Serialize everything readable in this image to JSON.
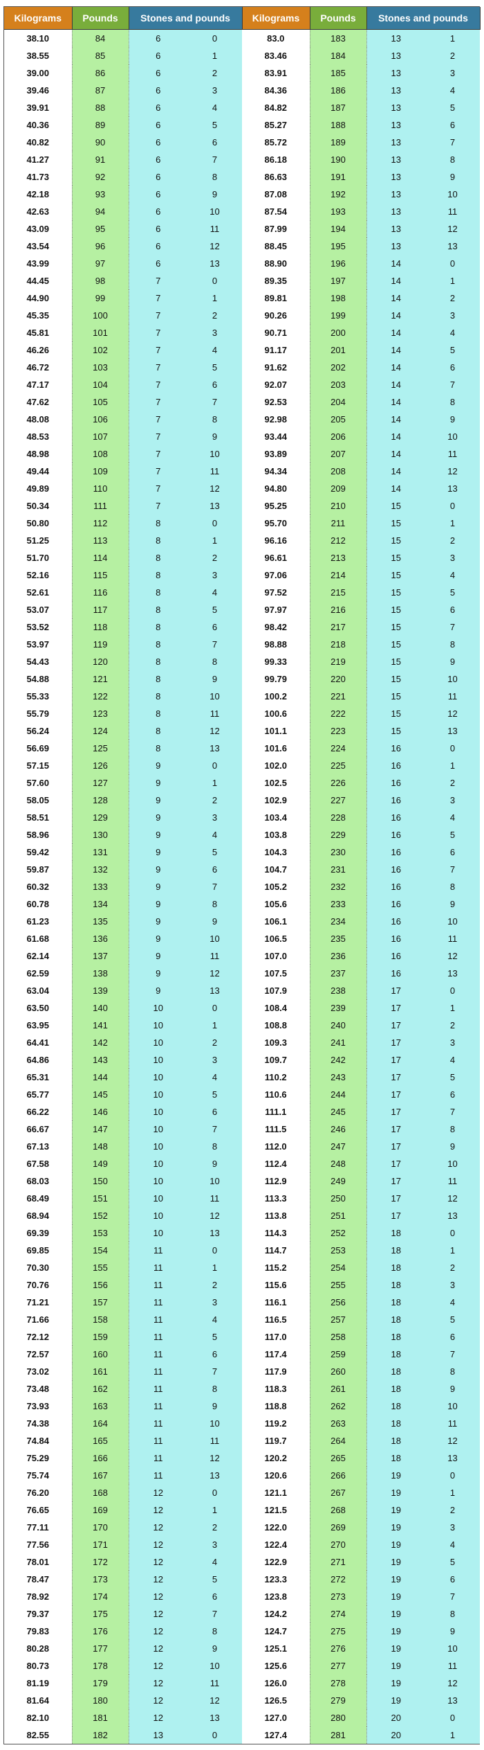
{
  "headers": {
    "kilograms": "Kilograms",
    "pounds": "Pounds",
    "stones_pounds": "Stones and pounds"
  },
  "left": [
    [
      "38.10",
      "84",
      "6",
      "0"
    ],
    [
      "38.55",
      "85",
      "6",
      "1"
    ],
    [
      "39.00",
      "86",
      "6",
      "2"
    ],
    [
      "39.46",
      "87",
      "6",
      "3"
    ],
    [
      "39.91",
      "88",
      "6",
      "4"
    ],
    [
      "40.36",
      "89",
      "6",
      "5"
    ],
    [
      "40.82",
      "90",
      "6",
      "6"
    ],
    [
      "41.27",
      "91",
      "6",
      "7"
    ],
    [
      "41.73",
      "92",
      "6",
      "8"
    ],
    [
      "42.18",
      "93",
      "6",
      "9"
    ],
    [
      "42.63",
      "94",
      "6",
      "10"
    ],
    [
      "43.09",
      "95",
      "6",
      "11"
    ],
    [
      "43.54",
      "96",
      "6",
      "12"
    ],
    [
      "43.99",
      "97",
      "6",
      "13"
    ],
    [
      "44.45",
      "98",
      "7",
      "0"
    ],
    [
      "44.90",
      "99",
      "7",
      "1"
    ],
    [
      "45.35",
      "100",
      "7",
      "2"
    ],
    [
      "45.81",
      "101",
      "7",
      "3"
    ],
    [
      "46.26",
      "102",
      "7",
      "4"
    ],
    [
      "46.72",
      "103",
      "7",
      "5"
    ],
    [
      "47.17",
      "104",
      "7",
      "6"
    ],
    [
      "47.62",
      "105",
      "7",
      "7"
    ],
    [
      "48.08",
      "106",
      "7",
      "8"
    ],
    [
      "48.53",
      "107",
      "7",
      "9"
    ],
    [
      "48.98",
      "108",
      "7",
      "10"
    ],
    [
      "49.44",
      "109",
      "7",
      "11"
    ],
    [
      "49.89",
      "110",
      "7",
      "12"
    ],
    [
      "50.34",
      "111",
      "7",
      "13"
    ],
    [
      "50.80",
      "112",
      "8",
      "0"
    ],
    [
      "51.25",
      "113",
      "8",
      "1"
    ],
    [
      "51.70",
      "114",
      "8",
      "2"
    ],
    [
      "52.16",
      "115",
      "8",
      "3"
    ],
    [
      "52.61",
      "116",
      "8",
      "4"
    ],
    [
      "53.07",
      "117",
      "8",
      "5"
    ],
    [
      "53.52",
      "118",
      "8",
      "6"
    ],
    [
      "53.97",
      "119",
      "8",
      "7"
    ],
    [
      "54.43",
      "120",
      "8",
      "8"
    ],
    [
      "54.88",
      "121",
      "8",
      "9"
    ],
    [
      "55.33",
      "122",
      "8",
      "10"
    ],
    [
      "55.79",
      "123",
      "8",
      "11"
    ],
    [
      "56.24",
      "124",
      "8",
      "12"
    ],
    [
      "56.69",
      "125",
      "8",
      "13"
    ],
    [
      "57.15",
      "126",
      "9",
      "0"
    ],
    [
      "57.60",
      "127",
      "9",
      "1"
    ],
    [
      "58.05",
      "128",
      "9",
      "2"
    ],
    [
      "58.51",
      "129",
      "9",
      "3"
    ],
    [
      "58.96",
      "130",
      "9",
      "4"
    ],
    [
      "59.42",
      "131",
      "9",
      "5"
    ],
    [
      "59.87",
      "132",
      "9",
      "6"
    ],
    [
      "60.32",
      "133",
      "9",
      "7"
    ],
    [
      "60.78",
      "134",
      "9",
      "8"
    ],
    [
      "61.23",
      "135",
      "9",
      "9"
    ],
    [
      "61.68",
      "136",
      "9",
      "10"
    ],
    [
      "62.14",
      "137",
      "9",
      "11"
    ],
    [
      "62.59",
      "138",
      "9",
      "12"
    ],
    [
      "63.04",
      "139",
      "9",
      "13"
    ],
    [
      "63.50",
      "140",
      "10",
      "0"
    ],
    [
      "63.95",
      "141",
      "10",
      "1"
    ],
    [
      "64.41",
      "142",
      "10",
      "2"
    ],
    [
      "64.86",
      "143",
      "10",
      "3"
    ],
    [
      "65.31",
      "144",
      "10",
      "4"
    ],
    [
      "65.77",
      "145",
      "10",
      "5"
    ],
    [
      "66.22",
      "146",
      "10",
      "6"
    ],
    [
      "66.67",
      "147",
      "10",
      "7"
    ],
    [
      "67.13",
      "148",
      "10",
      "8"
    ],
    [
      "67.58",
      "149",
      "10",
      "9"
    ],
    [
      "68.03",
      "150",
      "10",
      "10"
    ],
    [
      "68.49",
      "151",
      "10",
      "11"
    ],
    [
      "68.94",
      "152",
      "10",
      "12"
    ],
    [
      "69.39",
      "153",
      "10",
      "13"
    ],
    [
      "69.85",
      "154",
      "11",
      "0"
    ],
    [
      "70.30",
      "155",
      "11",
      "1"
    ],
    [
      "70.76",
      "156",
      "11",
      "2"
    ],
    [
      "71.21",
      "157",
      "11",
      "3"
    ],
    [
      "71.66",
      "158",
      "11",
      "4"
    ],
    [
      "72.12",
      "159",
      "11",
      "5"
    ],
    [
      "72.57",
      "160",
      "11",
      "6"
    ],
    [
      "73.02",
      "161",
      "11",
      "7"
    ],
    [
      "73.48",
      "162",
      "11",
      "8"
    ],
    [
      "73.93",
      "163",
      "11",
      "9"
    ],
    [
      "74.38",
      "164",
      "11",
      "10"
    ],
    [
      "74.84",
      "165",
      "11",
      "11"
    ],
    [
      "75.29",
      "166",
      "11",
      "12"
    ],
    [
      "75.74",
      "167",
      "11",
      "13"
    ],
    [
      "76.20",
      "168",
      "12",
      "0"
    ],
    [
      "76.65",
      "169",
      "12",
      "1"
    ],
    [
      "77.11",
      "170",
      "12",
      "2"
    ],
    [
      "77.56",
      "171",
      "12",
      "3"
    ],
    [
      "78.01",
      "172",
      "12",
      "4"
    ],
    [
      "78.47",
      "173",
      "12",
      "5"
    ],
    [
      "78.92",
      "174",
      "12",
      "6"
    ],
    [
      "79.37",
      "175",
      "12",
      "7"
    ],
    [
      "79.83",
      "176",
      "12",
      "8"
    ],
    [
      "80.28",
      "177",
      "12",
      "9"
    ],
    [
      "80.73",
      "178",
      "12",
      "10"
    ],
    [
      "81.19",
      "179",
      "12",
      "11"
    ],
    [
      "81.64",
      "180",
      "12",
      "12"
    ],
    [
      "82.10",
      "181",
      "12",
      "13"
    ],
    [
      "82.55",
      "182",
      "13",
      "0"
    ]
  ],
  "right": [
    [
      "83.0",
      "183",
      "13",
      "1"
    ],
    [
      "83.46",
      "184",
      "13",
      "2"
    ],
    [
      "83.91",
      "185",
      "13",
      "3"
    ],
    [
      "84.36",
      "186",
      "13",
      "4"
    ],
    [
      "84.82",
      "187",
      "13",
      "5"
    ],
    [
      "85.27",
      "188",
      "13",
      "6"
    ],
    [
      "85.72",
      "189",
      "13",
      "7"
    ],
    [
      "86.18",
      "190",
      "13",
      "8"
    ],
    [
      "86.63",
      "191",
      "13",
      "9"
    ],
    [
      "87.08",
      "192",
      "13",
      "10"
    ],
    [
      "87.54",
      "193",
      "13",
      "11"
    ],
    [
      "87.99",
      "194",
      "13",
      "12"
    ],
    [
      "88.45",
      "195",
      "13",
      "13"
    ],
    [
      "88.90",
      "196",
      "14",
      "0"
    ],
    [
      "89.35",
      "197",
      "14",
      "1"
    ],
    [
      "89.81",
      "198",
      "14",
      "2"
    ],
    [
      "90.26",
      "199",
      "14",
      "3"
    ],
    [
      "90.71",
      "200",
      "14",
      "4"
    ],
    [
      "91.17",
      "201",
      "14",
      "5"
    ],
    [
      "91.62",
      "202",
      "14",
      "6"
    ],
    [
      "92.07",
      "203",
      "14",
      "7"
    ],
    [
      "92.53",
      "204",
      "14",
      "8"
    ],
    [
      "92.98",
      "205",
      "14",
      "9"
    ],
    [
      "93.44",
      "206",
      "14",
      "10"
    ],
    [
      "93.89",
      "207",
      "14",
      "11"
    ],
    [
      "94.34",
      "208",
      "14",
      "12"
    ],
    [
      "94.80",
      "209",
      "14",
      "13"
    ],
    [
      "95.25",
      "210",
      "15",
      "0"
    ],
    [
      "95.70",
      "211",
      "15",
      "1"
    ],
    [
      "96.16",
      "212",
      "15",
      "2"
    ],
    [
      "96.61",
      "213",
      "15",
      "3"
    ],
    [
      "97.06",
      "214",
      "15",
      "4"
    ],
    [
      "97.52",
      "215",
      "15",
      "5"
    ],
    [
      "97.97",
      "216",
      "15",
      "6"
    ],
    [
      "98.42",
      "217",
      "15",
      "7"
    ],
    [
      "98.88",
      "218",
      "15",
      "8"
    ],
    [
      "99.33",
      "219",
      "15",
      "9"
    ],
    [
      "99.79",
      "220",
      "15",
      "10"
    ],
    [
      "100.2",
      "221",
      "15",
      "11"
    ],
    [
      "100.6",
      "222",
      "15",
      "12"
    ],
    [
      "101.1",
      "223",
      "15",
      "13"
    ],
    [
      "101.6",
      "224",
      "16",
      "0"
    ],
    [
      "102.0",
      "225",
      "16",
      "1"
    ],
    [
      "102.5",
      "226",
      "16",
      "2"
    ],
    [
      "102.9",
      "227",
      "16",
      "3"
    ],
    [
      "103.4",
      "228",
      "16",
      "4"
    ],
    [
      "103.8",
      "229",
      "16",
      "5"
    ],
    [
      "104.3",
      "230",
      "16",
      "6"
    ],
    [
      "104.7",
      "231",
      "16",
      "7"
    ],
    [
      "105.2",
      "232",
      "16",
      "8"
    ],
    [
      "105.6",
      "233",
      "16",
      "9"
    ],
    [
      "106.1",
      "234",
      "16",
      "10"
    ],
    [
      "106.5",
      "235",
      "16",
      "11"
    ],
    [
      "107.0",
      "236",
      "16",
      "12"
    ],
    [
      "107.5",
      "237",
      "16",
      "13"
    ],
    [
      "107.9",
      "238",
      "17",
      "0"
    ],
    [
      "108.4",
      "239",
      "17",
      "1"
    ],
    [
      "108.8",
      "240",
      "17",
      "2"
    ],
    [
      "109.3",
      "241",
      "17",
      "3"
    ],
    [
      "109.7",
      "242",
      "17",
      "4"
    ],
    [
      "110.2",
      "243",
      "17",
      "5"
    ],
    [
      "110.6",
      "244",
      "17",
      "6"
    ],
    [
      "111.1",
      "245",
      "17",
      "7"
    ],
    [
      "111.5",
      "246",
      "17",
      "8"
    ],
    [
      "112.0",
      "247",
      "17",
      "9"
    ],
    [
      "112.4",
      "248",
      "17",
      "10"
    ],
    [
      "112.9",
      "249",
      "17",
      "11"
    ],
    [
      "113.3",
      "250",
      "17",
      "12"
    ],
    [
      "113.8",
      "251",
      "17",
      "13"
    ],
    [
      "114.3",
      "252",
      "18",
      "0"
    ],
    [
      "114.7",
      "253",
      "18",
      "1"
    ],
    [
      "115.2",
      "254",
      "18",
      "2"
    ],
    [
      "115.6",
      "255",
      "18",
      "3"
    ],
    [
      "116.1",
      "256",
      "18",
      "4"
    ],
    [
      "116.5",
      "257",
      "18",
      "5"
    ],
    [
      "117.0",
      "258",
      "18",
      "6"
    ],
    [
      "117.4",
      "259",
      "18",
      "7"
    ],
    [
      "117.9",
      "260",
      "18",
      "8"
    ],
    [
      "118.3",
      "261",
      "18",
      "9"
    ],
    [
      "118.8",
      "262",
      "18",
      "10"
    ],
    [
      "119.2",
      "263",
      "18",
      "11"
    ],
    [
      "119.7",
      "264",
      "18",
      "12"
    ],
    [
      "120.2",
      "265",
      "18",
      "13"
    ],
    [
      "120.6",
      "266",
      "19",
      "0"
    ],
    [
      "121.1",
      "267",
      "19",
      "1"
    ],
    [
      "121.5",
      "268",
      "19",
      "2"
    ],
    [
      "122.0",
      "269",
      "19",
      "3"
    ],
    [
      "122.4",
      "270",
      "19",
      "4"
    ],
    [
      "122.9",
      "271",
      "19",
      "5"
    ],
    [
      "123.3",
      "272",
      "19",
      "6"
    ],
    [
      "123.8",
      "273",
      "19",
      "7"
    ],
    [
      "124.2",
      "274",
      "19",
      "8"
    ],
    [
      "124.7",
      "275",
      "19",
      "9"
    ],
    [
      "125.1",
      "276",
      "19",
      "10"
    ],
    [
      "125.6",
      "277",
      "19",
      "11"
    ],
    [
      "126.0",
      "278",
      "19",
      "12"
    ],
    [
      "126.5",
      "279",
      "19",
      "13"
    ],
    [
      "127.0",
      "280",
      "20",
      "0"
    ],
    [
      "127.4",
      "281",
      "20",
      "1"
    ]
  ]
}
